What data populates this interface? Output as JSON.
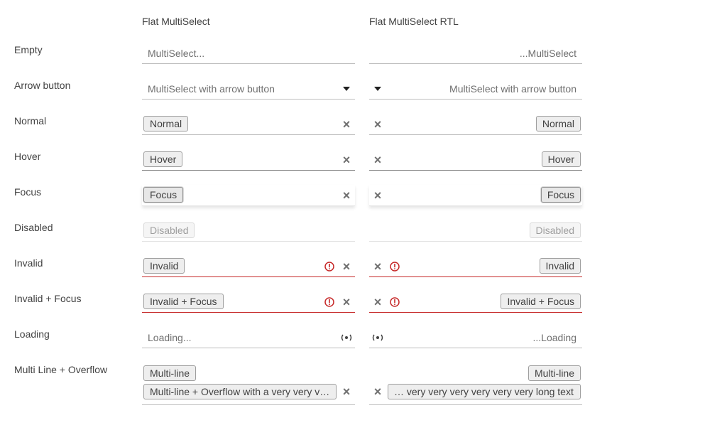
{
  "columns": {
    "ltr_header": "Flat MultiSelect",
    "rtl_header": "Flat MultiSelect RTL"
  },
  "rows": [
    {
      "label": "Empty",
      "ltr": {
        "placeholder": "MultiSelect..."
      },
      "rtl": {
        "placeholder": "...MultiSelect"
      }
    },
    {
      "label": "Arrow button",
      "ltr": {
        "placeholder": "MultiSelect with arrow button"
      },
      "rtl": {
        "placeholder": "MultiSelect with arrow button"
      }
    },
    {
      "label": "Normal",
      "ltr": {
        "chip": "Normal"
      },
      "rtl": {
        "chip": "Normal"
      }
    },
    {
      "label": "Hover",
      "ltr": {
        "chip": "Hover"
      },
      "rtl": {
        "chip": "Hover"
      }
    },
    {
      "label": "Focus",
      "ltr": {
        "chip": "Focus"
      },
      "rtl": {
        "chip": "Focus"
      }
    },
    {
      "label": "Disabled",
      "ltr": {
        "chip": "Disabled"
      },
      "rtl": {
        "chip": "Disabled"
      }
    },
    {
      "label": "Invalid",
      "ltr": {
        "chip": "Invalid"
      },
      "rtl": {
        "chip": "Invalid"
      }
    },
    {
      "label": "Invalid + Focus",
      "ltr": {
        "chip": "Invalid + Focus"
      },
      "rtl": {
        "chip": "Invalid + Focus"
      }
    },
    {
      "label": "Loading",
      "ltr": {
        "placeholder": "Loading..."
      },
      "rtl": {
        "placeholder": "...Loading"
      }
    },
    {
      "label": "Multi Line + Overflow",
      "ltr": {
        "chip_1": "Multi-line",
        "chip_2": "Multi-line + Overflow with a very very very very very very long text"
      },
      "rtl": {
        "chip_1": "Multi-line",
        "chip_2": "… very very very very very very long text"
      }
    }
  ],
  "icons": {
    "clear": "close-icon",
    "arrow": "chevron-down-icon",
    "error": "error-icon",
    "loading": "loading-icon"
  },
  "colors": {
    "text": "#424242",
    "underline": "#bdbdbd",
    "error": "#c62828",
    "chip_border": "#9e9e9e",
    "chip_background": "#eeeeee"
  }
}
